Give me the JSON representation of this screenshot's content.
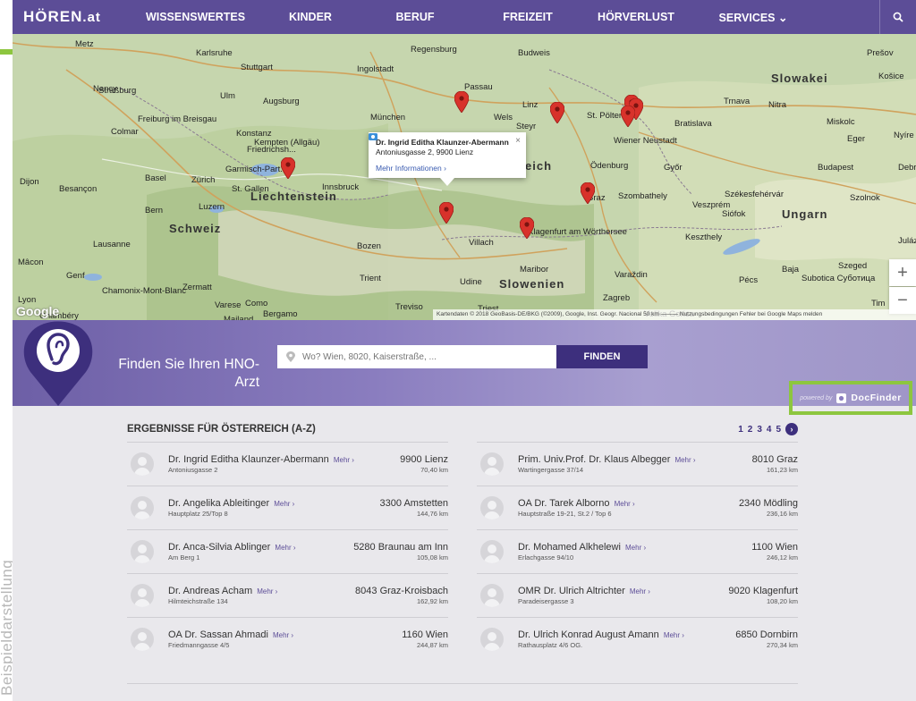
{
  "side_caption": "Beispieldarstellung",
  "nav": {
    "logo": "HÖREN",
    "logo_suffix": ".at",
    "items": [
      {
        "label": "WISSENSWERTES"
      },
      {
        "label": "KINDER"
      },
      {
        "label": "BERUF"
      },
      {
        "label": "FREIZEIT"
      },
      {
        "label": "HÖRVERLUST"
      },
      {
        "label": "SERVICES ⌄"
      }
    ],
    "search_icon": "magnifier-icon"
  },
  "map": {
    "countries": [
      "Slowakei",
      "Schweiz",
      "Ungarn",
      "Liechtenstein",
      "Slowenien",
      "eich"
    ],
    "cities": [
      "Metz",
      "Karlsruhe",
      "Regensburg",
      "Budweis",
      "Prešov",
      "Stuttgart",
      "Ingolstadt",
      "Košice",
      "Nancy",
      "Straßburg",
      "Passau",
      "Trnava",
      "Nitra",
      "Ulm",
      "Augsburg",
      "Linz",
      "Wels",
      "Steyr",
      "St. Pölten",
      "Freiburg im Breisgau",
      "München",
      "Bratislava",
      "Miskolc",
      "Colmar",
      "Konstanz",
      "Kempten (Allgäu)",
      "Wiener Neustadt",
      "Eger",
      "Nyíre",
      "Friedrichsh...",
      "Garmisch-Part...",
      "Budapest",
      "Dijon",
      "Besançon",
      "Basel",
      "Zürich",
      "St. Gallen",
      "Innsbruck",
      "Ödenburg",
      "Győr",
      "Debre",
      "Luzern",
      "Szombathely",
      "Székesfehérvár",
      "Szolnok",
      "Bern",
      "Veszprém",
      "Siófok",
      "Graz",
      "Klagenfurt am Wörthersee",
      "Keszthely",
      "Lausanne",
      "Bozen",
      "Villach",
      "Maribor",
      "Juláz",
      "Mâcon",
      "Genf",
      "Trient",
      "Varaždin",
      "Szeged",
      "Udine",
      "Pécs",
      "Baja",
      "Subotica Суботица",
      "Chamonix-Mont-Blanc",
      "Zermatt",
      "Lyon",
      "Varese",
      "Como",
      "Bergamo",
      "Treviso",
      "Triest",
      "Zagreb",
      "Velika Gorica",
      "Chambéry",
      "Mailand",
      "Tim"
    ],
    "zoom_in": "+",
    "zoom_out": "−",
    "google_logo": "Google",
    "footer": "Kartendaten © 2018 GeoBasis-DE/BKG (©2009), Google, Inst. Geogr. Nacional   50 km ⎯⎯⎯⎯⎯⎯  Nutzungsbedingungen   Fehler bei Google Maps melden",
    "info_window": {
      "name": "Dr. Ingrid Editha Klaunzer-Abermann",
      "address": "Antoniusgasse 2, 9900 Lienz",
      "link": "Mehr Informationen ›",
      "close": "×"
    }
  },
  "search": {
    "title": "Finden Sie Ihren HNO-Arzt",
    "placeholder": "Wo? Wien, 8020, Kaiserstraße, ...",
    "button": "FINDEN",
    "powered_by": "powered by",
    "powered_brand": "DocFinder"
  },
  "results": {
    "title": "ERGEBNISSE FÜR ÖSTERREICH (A-Z)",
    "pages": [
      "1",
      "2",
      "3",
      "4",
      "5"
    ],
    "more_label": "Mehr ›",
    "left": [
      {
        "name": "Dr. Ingrid Editha Klaunzer-Abermann",
        "address": "Antoniusgasse 2",
        "city": "9900 Lienz",
        "distance": "70,40 km"
      },
      {
        "name": "Dr. Angelika Ableitinger",
        "address": "Hauptplatz 25/Top 8",
        "city": "3300 Amstetten",
        "distance": "144,76 km"
      },
      {
        "name": "Dr. Anca-Silvia Ablinger",
        "address": "Am Berg 1",
        "city": "5280 Braunau am Inn",
        "distance": "105,08 km"
      },
      {
        "name": "Dr. Andreas Acham",
        "address": "Hilmteichstraße 134",
        "city": "8043 Graz-Kroisbach",
        "distance": "162,92 km"
      },
      {
        "name": "OA Dr. Sassan Ahmadi",
        "address": "Friedmanngasse 4/5",
        "city": "1160 Wien",
        "distance": "244,87 km"
      }
    ],
    "right": [
      {
        "name": "Prim. Univ.Prof. Dr. Klaus Albegger",
        "address": "Wartingergasse 37/14",
        "city": "8010 Graz",
        "distance": "161,23 km"
      },
      {
        "name": "OA Dr. Tarek Alborno",
        "address": "Hauptstraße 19-21, St.2 / Top 6",
        "city": "2340 Mödling",
        "distance": "236,16 km"
      },
      {
        "name": "Dr. Mohamed Alkhelewi",
        "address": "Erlachgasse 94/10",
        "city": "1100 Wien",
        "distance": "246,12 km"
      },
      {
        "name": "OMR Dr. Ulrich Altrichter",
        "address": "Paradeisergasse 3",
        "city": "9020 Klagenfurt",
        "distance": "108,20 km"
      },
      {
        "name": "Dr. Ulrich Konrad August Amann",
        "address": "Rathausplatz 4/6 OG.",
        "city": "6850 Dornbirn",
        "distance": "270,34 km"
      }
    ]
  }
}
